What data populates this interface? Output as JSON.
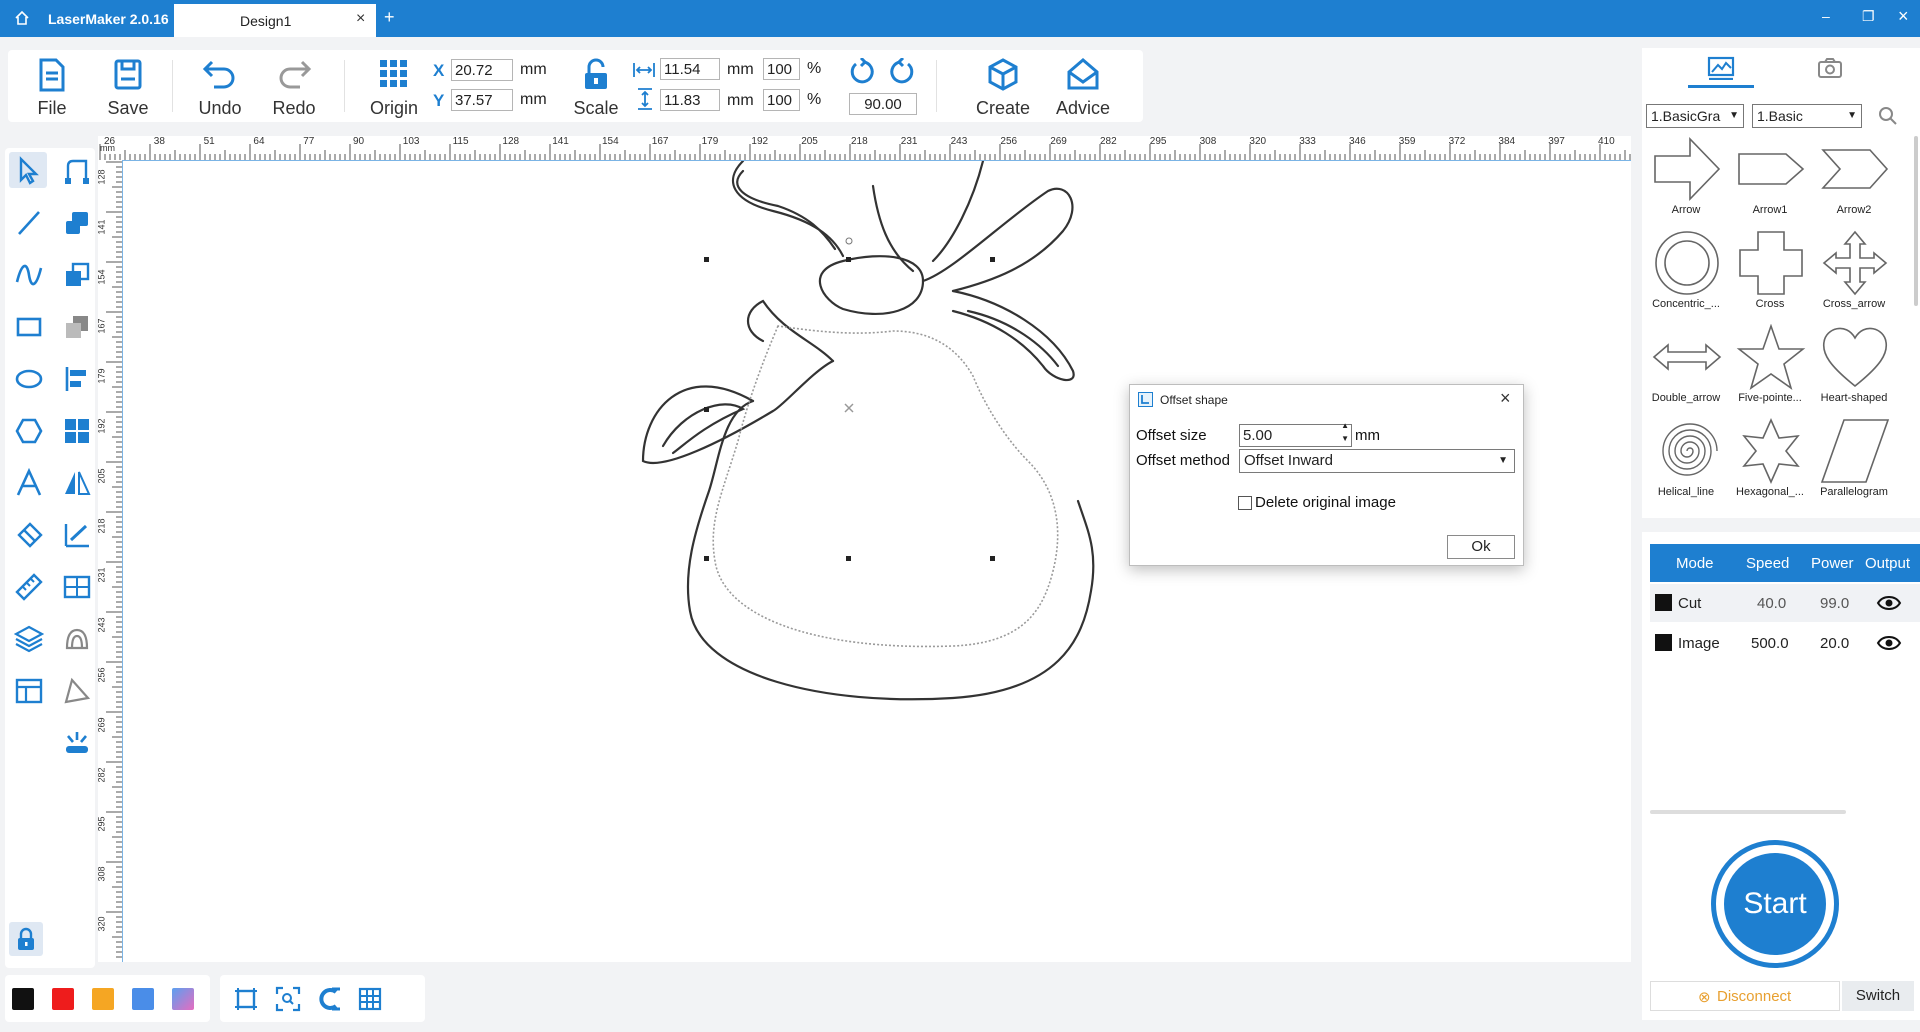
{
  "app": {
    "title": "LaserMaker 2.0.16",
    "tab_title": "Design1",
    "tab_close": "×",
    "tab_add": "+",
    "win_min": "–",
    "win_max": "❐",
    "win_close": "×"
  },
  "toolbar": {
    "file": "File",
    "save": "Save",
    "undo": "Undo",
    "redo": "Redo",
    "origin": "Origin",
    "scale": "Scale",
    "create": "Create",
    "advice": "Advice",
    "x_label": "X",
    "y_label": "Y",
    "x_value": "20.72",
    "y_value": "37.57",
    "unit_mm": "mm",
    "width_value": "11.54",
    "height_value": "11.83",
    "width_pct": "100",
    "height_pct": "100",
    "pct": "%",
    "rotation_value": "90.00"
  },
  "ruler": {
    "unit": "mm",
    "top": [
      "26",
      "38",
      "51",
      "64",
      "77",
      "90",
      "103",
      "115",
      "128",
      "141",
      "154",
      "167",
      "179",
      "192",
      "205",
      "218",
      "231",
      "243",
      "256",
      "269",
      "282",
      "295",
      "308",
      "320",
      "333",
      "346",
      "359",
      "372",
      "384",
      "397",
      "410"
    ],
    "left": [
      "128",
      "141",
      "154",
      "167",
      "179",
      "192",
      "205",
      "218",
      "231",
      "243",
      "256",
      "269",
      "282",
      "295",
      "308",
      "320"
    ]
  },
  "left_tools": [
    "select-tool-icon",
    "node-edit-icon",
    "line-tool-icon",
    "fill-icon",
    "curve-tool-icon",
    "copy-icon",
    "rectangle-tool-icon",
    "combine-icon",
    "ellipse-tool-icon",
    "align-icon",
    "polygon-tool-icon",
    "array-icon",
    "text-tool-icon",
    "mirror-icon",
    "eraser-icon",
    "trace-icon",
    "measure-icon",
    "group-icon",
    "layers-icon",
    "offset-icon",
    "table-icon",
    "path-icon",
    "explode-icon"
  ],
  "bottom": {
    "colors": [
      "#111111",
      "#ee1c1c",
      "#f5a623",
      "#4a8de8",
      "gradient"
    ],
    "tools": [
      "fit-frame-icon",
      "zoom-fit-icon",
      "magnet-icon",
      "grid-icon"
    ]
  },
  "right_panel": {
    "category_select": "1.BasicGra",
    "sub_select": "1.Basic",
    "shapes": [
      "Arrow",
      "Arrow1",
      "Arrow2",
      "Concentric_...",
      "Cross",
      "Cross_arrow",
      "Double_arrow",
      "Five-pointe...",
      "Heart-shaped",
      "Helical_line",
      "Hexagonal_...",
      "Parallelogram"
    ]
  },
  "layers": {
    "headers": {
      "mode": "Mode",
      "speed": "Speed",
      "power": "Power",
      "output": "Output"
    },
    "rows": [
      {
        "mode": "Cut",
        "speed": "40.0",
        "power": "99.0",
        "color": "#111111"
      },
      {
        "mode": "Image",
        "speed": "500.0",
        "power": "20.0",
        "color": "#111111"
      }
    ]
  },
  "device": {
    "start": "Start",
    "disconnect": "Disconnect",
    "switch": "Switch"
  },
  "dialog": {
    "title": "Offset shape",
    "close": "×",
    "offset_size_label": "Offset size",
    "offset_size_value": "5.00",
    "offset_size_unit": "mm",
    "offset_method_label": "Offset method",
    "offset_method_value": "Offset Inward",
    "delete_original_label": "Delete original image",
    "delete_original_checked": false,
    "ok": "Ok"
  }
}
